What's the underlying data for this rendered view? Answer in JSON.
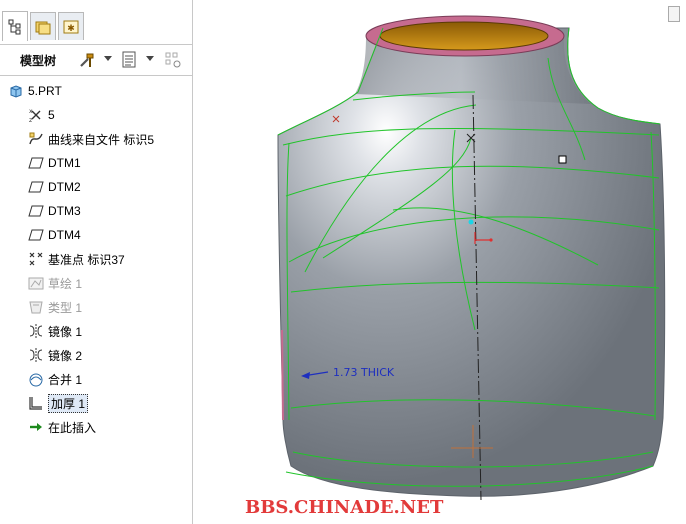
{
  "model_tree": {
    "header_label": "模型树",
    "items": [
      {
        "label": "5.PRT",
        "icon": "part-icon",
        "dim": false,
        "selected": false
      },
      {
        "label": "5",
        "icon": "csys-icon",
        "dim": false,
        "selected": false
      },
      {
        "label": "曲线来自文件 标识5",
        "icon": "curve-from-file-icon",
        "dim": false,
        "selected": false
      },
      {
        "label": "DTM1",
        "icon": "datum-plane-icon",
        "dim": false,
        "selected": false
      },
      {
        "label": "DTM2",
        "icon": "datum-plane-icon",
        "dim": false,
        "selected": false
      },
      {
        "label": "DTM3",
        "icon": "datum-plane-icon",
        "dim": false,
        "selected": false
      },
      {
        "label": "DTM4",
        "icon": "datum-plane-icon",
        "dim": false,
        "selected": false
      },
      {
        "label": "基准点 标识37",
        "icon": "datum-point-icon",
        "dim": false,
        "selected": false
      },
      {
        "label": "草绘 1",
        "icon": "sketch-icon",
        "dim": true,
        "selected": false
      },
      {
        "label": "类型 1",
        "icon": "style-icon",
        "dim": true,
        "selected": false
      },
      {
        "label": "镜像 1",
        "icon": "mirror-icon",
        "dim": false,
        "selected": false
      },
      {
        "label": "镜像 2",
        "icon": "mirror-icon",
        "dim": false,
        "selected": false
      },
      {
        "label": "合并 1",
        "icon": "merge-icon",
        "dim": false,
        "selected": false
      },
      {
        "label": "加厚 1",
        "icon": "thicken-icon",
        "dim": false,
        "selected": true
      },
      {
        "label": "在此插入",
        "icon": "insert-here-icon",
        "dim": false,
        "selected": false
      }
    ]
  },
  "viewport": {
    "annotation": "1.73 THICK",
    "watermark": "BBS.CHINADE.NET",
    "colors": {
      "body": "#8a9099",
      "curves": "#21c42a",
      "rim": "#c66b8f",
      "interior": "#c98a10",
      "annotation": "#1e2fbf",
      "watermark": "#e23a3a"
    }
  }
}
